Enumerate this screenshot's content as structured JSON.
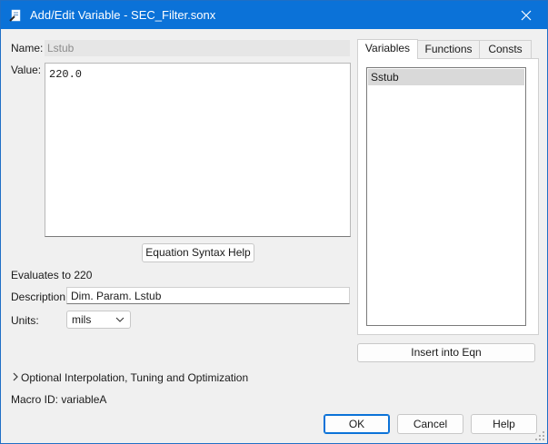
{
  "window": {
    "title": "Add/Edit Variable - SEC_Filter.sonx",
    "close_icon": "close-icon",
    "app_icon": "pencil-document-icon"
  },
  "form": {
    "name_label": "Name:",
    "name_value": "Lstub",
    "value_label": "Value:",
    "value_text": "220.0",
    "syntax_help_label": "Equation Syntax Help",
    "evaluates_label": "Evaluates to 220",
    "description_label": "Description:",
    "description_value": "Dim. Param. Lstub",
    "units_label": "Units:",
    "units_value": "mils",
    "optional_label": "Optional Interpolation, Tuning and Optimization",
    "macro_id_label": "Macro ID: variableA"
  },
  "side_panel": {
    "tabs": [
      {
        "label": "Variables",
        "active": true
      },
      {
        "label": "Functions",
        "active": false
      },
      {
        "label": "Consts",
        "active": false
      }
    ],
    "variables": [
      "Sstub"
    ],
    "insert_button_label": "Insert into Eqn"
  },
  "buttons": {
    "ok_label": "OK",
    "cancel_label": "Cancel",
    "help_label": "Help"
  },
  "colors": {
    "titlebar": "#0b72d8",
    "accent": "#0b72d8"
  }
}
